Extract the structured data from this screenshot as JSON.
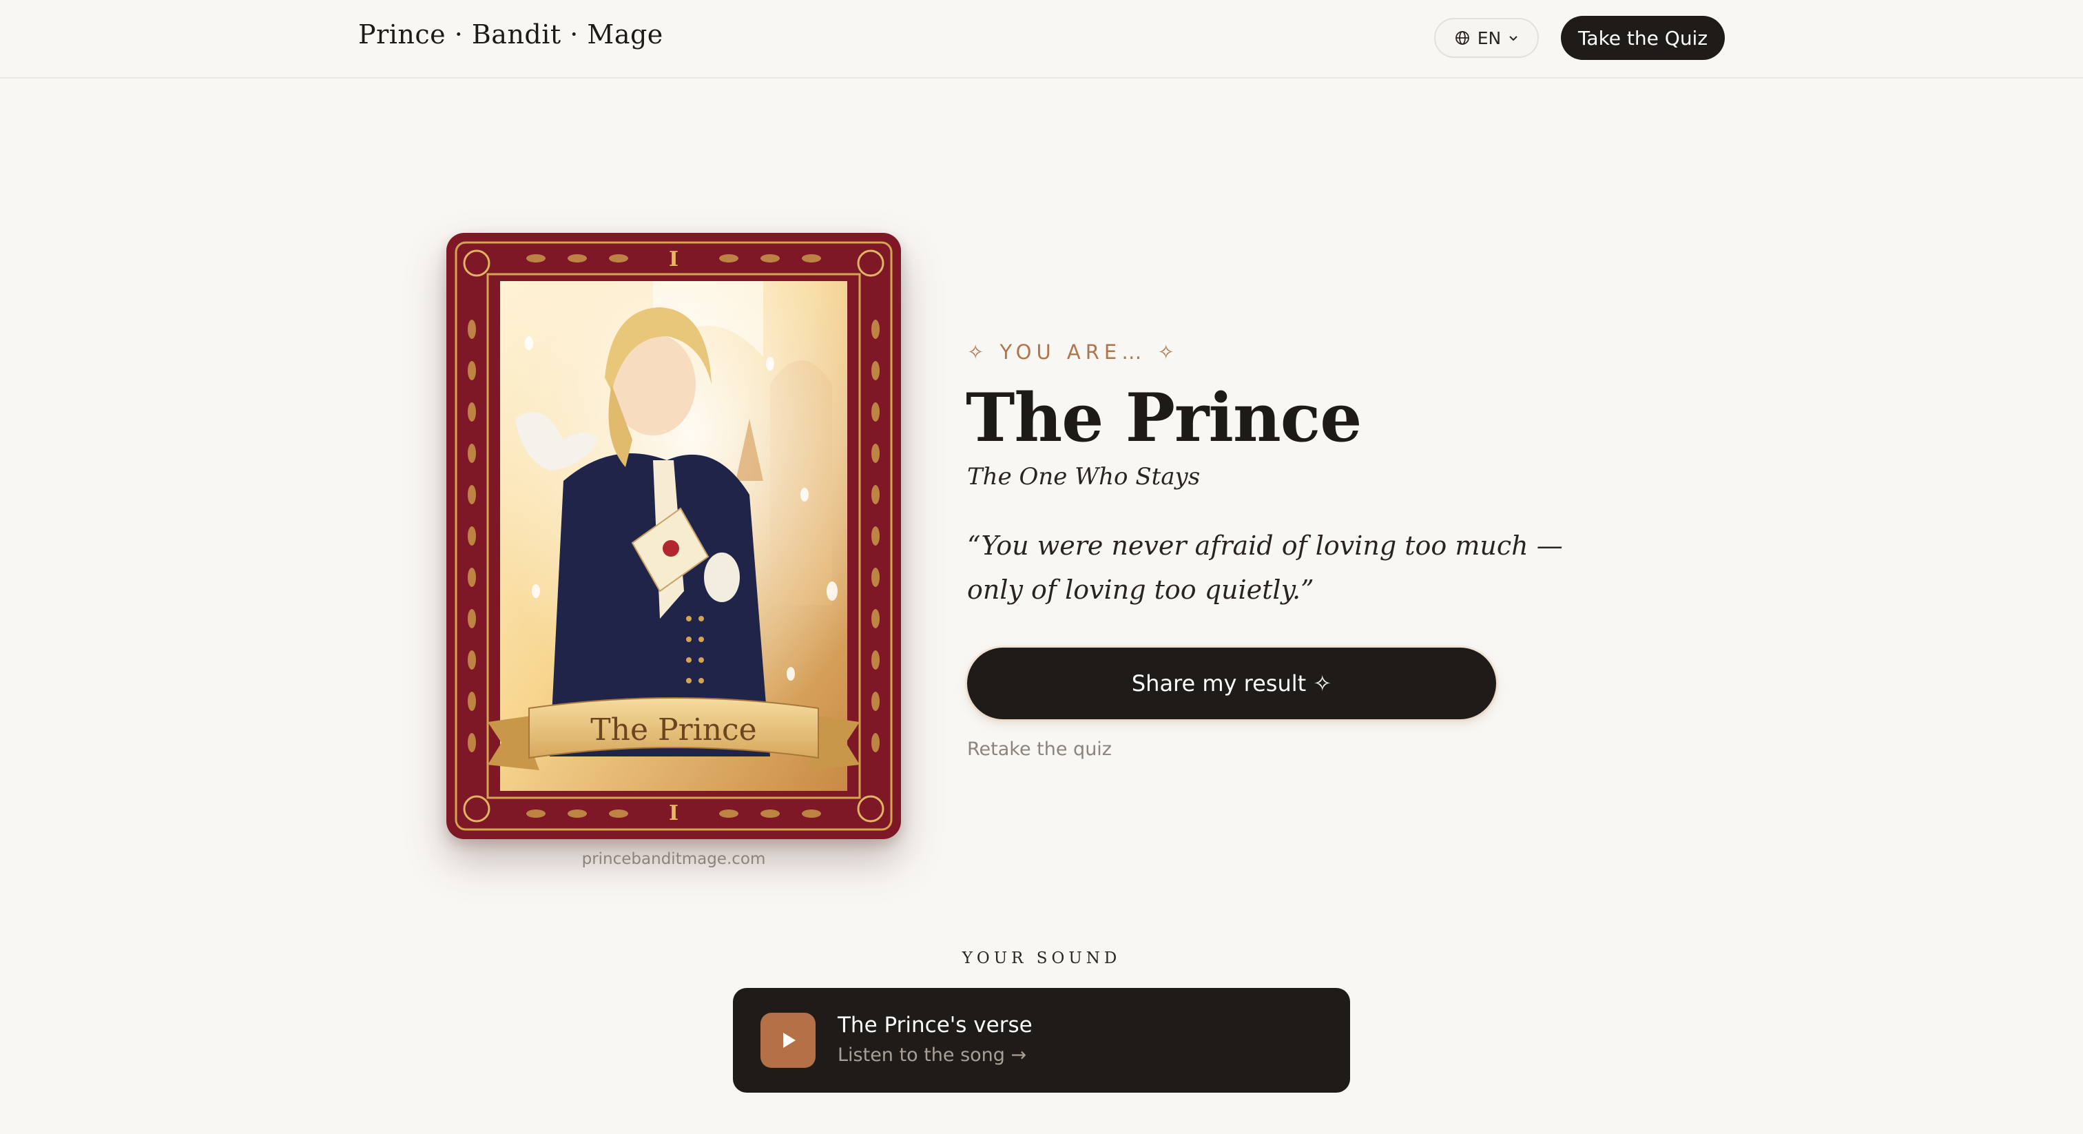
{
  "header": {
    "brand": "Prince · Bandit · Mage",
    "language": "EN",
    "quiz_button": "Take the Quiz"
  },
  "card": {
    "numeral": "I",
    "banner_text": "The Prince",
    "domain": "princebanditmage.com",
    "colors": {
      "frame": "#7e1826",
      "gold": "#d4a452",
      "coat": "#1f2448"
    }
  },
  "result": {
    "eyebrow": "✧ YOU ARE… ✧",
    "title": "The Prince",
    "subtitle": "The One Who Stays",
    "quote": "“You were never afraid of loving too much — only of loving too quietly.”",
    "share_button": "Share my result ✧",
    "retake_link": "Retake the quiz"
  },
  "sound": {
    "label": "YOUR SOUND",
    "song_title": "The Prince's verse",
    "song_subtitle": "Listen to the song →"
  },
  "colors": {
    "background": "#f9f7f4",
    "dark": "#1f1b18",
    "accent": "#b0754d",
    "play": "#b47046"
  }
}
